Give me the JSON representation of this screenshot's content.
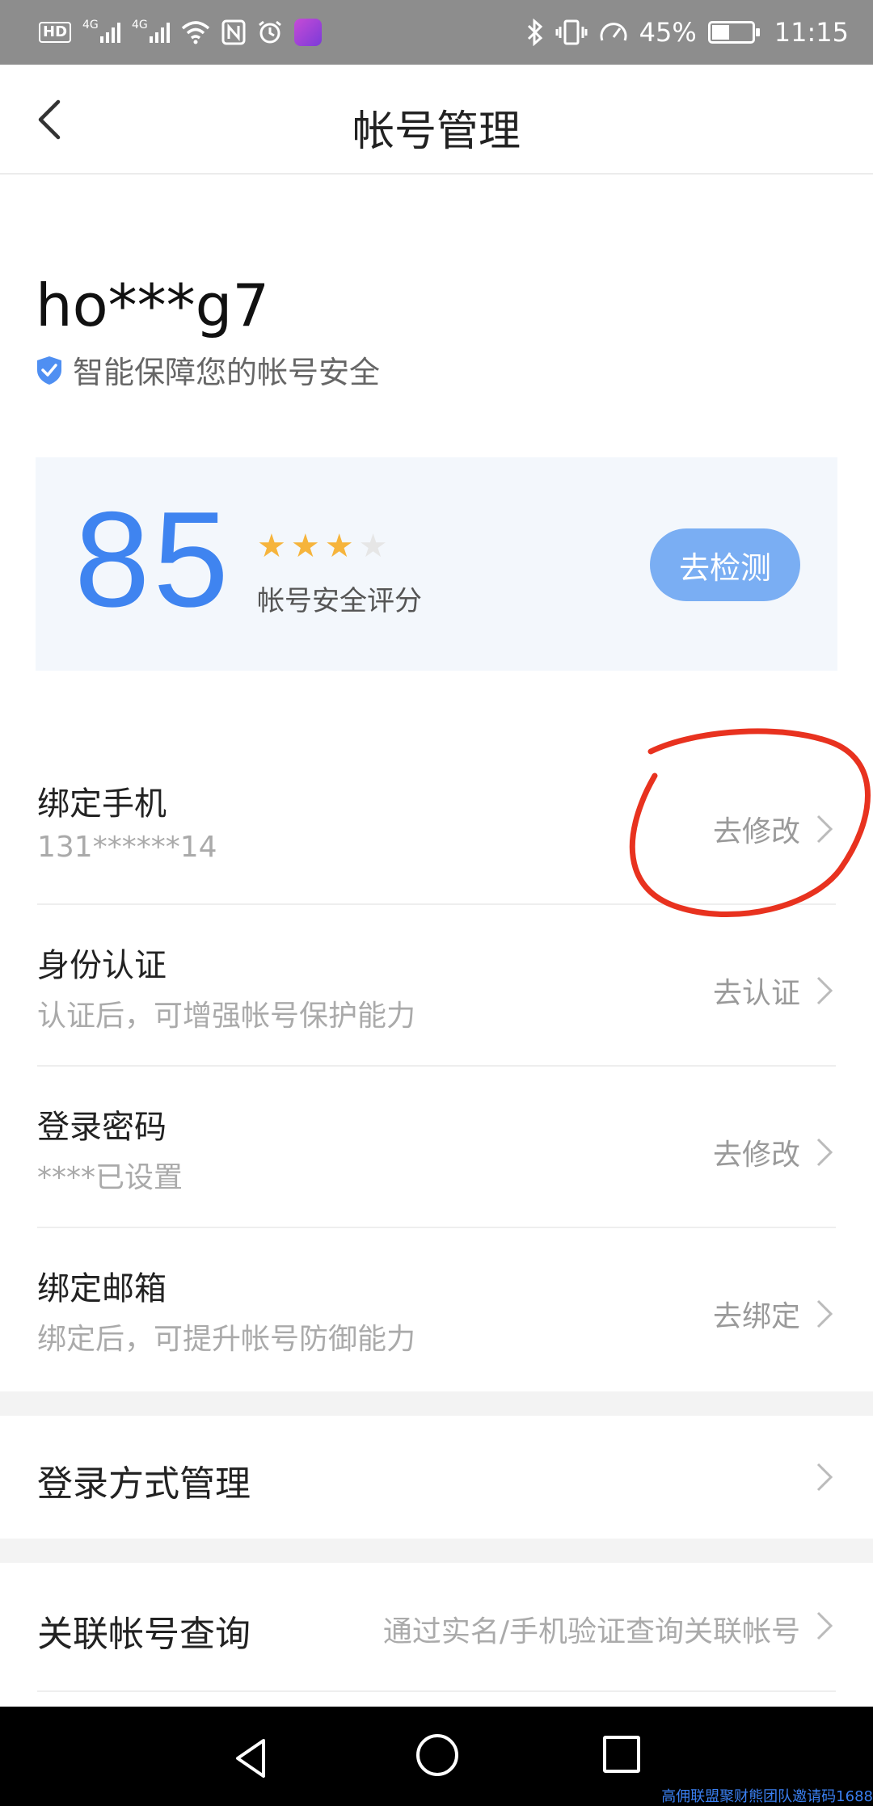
{
  "status_bar": {
    "network_badge": "HD",
    "signal1_type": "4G",
    "signal2_type": "4G",
    "battery": "45%",
    "time": "11:15",
    "icons": [
      "hd-icon",
      "signal-icon",
      "signal-icon",
      "wifi-icon",
      "nfc-icon",
      "alarm-icon",
      "app-icon",
      "bluetooth-icon",
      "vibrate-icon",
      "speed-icon",
      "battery-icon"
    ]
  },
  "header": {
    "title": "帐号管理",
    "back_icon": "chevron-left-icon"
  },
  "account": {
    "username": "ho***g7",
    "safety_text": "智能保障您的帐号安全",
    "shield_icon": "shield-check-icon"
  },
  "score_card": {
    "score": "85",
    "stars_filled": 3,
    "stars_total": 4,
    "label": "帐号安全评分",
    "button": "去检测"
  },
  "rows": [
    {
      "title": "绑定手机",
      "subtitle": "131******14",
      "action": "去修改"
    },
    {
      "title": "身份认证",
      "subtitle": "认证后，可增强帐号保护能力",
      "action": "去认证"
    },
    {
      "title": "登录密码",
      "subtitle": "****已设置",
      "action": "去修改"
    },
    {
      "title": "绑定邮箱",
      "subtitle": "绑定后，可提升帐号防御能力",
      "action": "去绑定"
    }
  ],
  "login_methods": {
    "title": "登录方式管理"
  },
  "linked_accounts": {
    "title": "关联帐号查询",
    "hint": "通过实名/手机验证查询关联帐号"
  },
  "watermark": "高佣联盟聚财熊团队邀请码1688",
  "colors": {
    "accent": "#3f84f0",
    "button": "#7aaef3",
    "star": "#f6b43c",
    "annotation": "#e8321f",
    "card_bg": "#f3f7fc"
  }
}
